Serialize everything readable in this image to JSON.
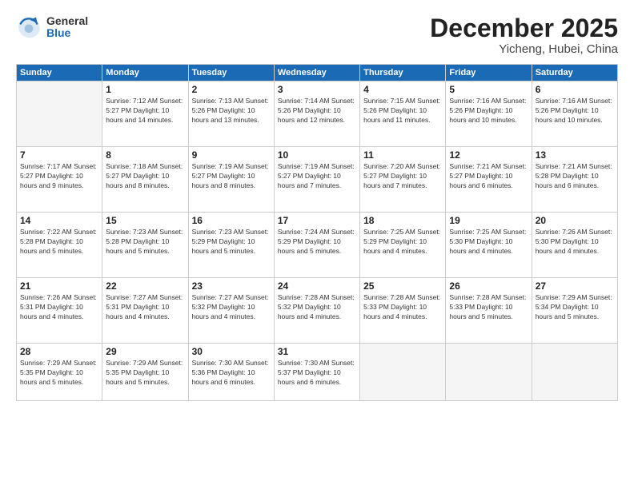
{
  "logo": {
    "general": "General",
    "blue": "Blue"
  },
  "header": {
    "month": "December 2025",
    "location": "Yicheng, Hubei, China"
  },
  "weekdays": [
    "Sunday",
    "Monday",
    "Tuesday",
    "Wednesday",
    "Thursday",
    "Friday",
    "Saturday"
  ],
  "weeks": [
    [
      {
        "day": "",
        "info": ""
      },
      {
        "day": "1",
        "info": "Sunrise: 7:12 AM\nSunset: 5:27 PM\nDaylight: 10 hours\nand 14 minutes."
      },
      {
        "day": "2",
        "info": "Sunrise: 7:13 AM\nSunset: 5:26 PM\nDaylight: 10 hours\nand 13 minutes."
      },
      {
        "day": "3",
        "info": "Sunrise: 7:14 AM\nSunset: 5:26 PM\nDaylight: 10 hours\nand 12 minutes."
      },
      {
        "day": "4",
        "info": "Sunrise: 7:15 AM\nSunset: 5:26 PM\nDaylight: 10 hours\nand 11 minutes."
      },
      {
        "day": "5",
        "info": "Sunrise: 7:16 AM\nSunset: 5:26 PM\nDaylight: 10 hours\nand 10 minutes."
      },
      {
        "day": "6",
        "info": "Sunrise: 7:16 AM\nSunset: 5:26 PM\nDaylight: 10 hours\nand 10 minutes."
      }
    ],
    [
      {
        "day": "7",
        "info": "Sunrise: 7:17 AM\nSunset: 5:27 PM\nDaylight: 10 hours\nand 9 minutes."
      },
      {
        "day": "8",
        "info": "Sunrise: 7:18 AM\nSunset: 5:27 PM\nDaylight: 10 hours\nand 8 minutes."
      },
      {
        "day": "9",
        "info": "Sunrise: 7:19 AM\nSunset: 5:27 PM\nDaylight: 10 hours\nand 8 minutes."
      },
      {
        "day": "10",
        "info": "Sunrise: 7:19 AM\nSunset: 5:27 PM\nDaylight: 10 hours\nand 7 minutes."
      },
      {
        "day": "11",
        "info": "Sunrise: 7:20 AM\nSunset: 5:27 PM\nDaylight: 10 hours\nand 7 minutes."
      },
      {
        "day": "12",
        "info": "Sunrise: 7:21 AM\nSunset: 5:27 PM\nDaylight: 10 hours\nand 6 minutes."
      },
      {
        "day": "13",
        "info": "Sunrise: 7:21 AM\nSunset: 5:28 PM\nDaylight: 10 hours\nand 6 minutes."
      }
    ],
    [
      {
        "day": "14",
        "info": "Sunrise: 7:22 AM\nSunset: 5:28 PM\nDaylight: 10 hours\nand 5 minutes."
      },
      {
        "day": "15",
        "info": "Sunrise: 7:23 AM\nSunset: 5:28 PM\nDaylight: 10 hours\nand 5 minutes."
      },
      {
        "day": "16",
        "info": "Sunrise: 7:23 AM\nSunset: 5:29 PM\nDaylight: 10 hours\nand 5 minutes."
      },
      {
        "day": "17",
        "info": "Sunrise: 7:24 AM\nSunset: 5:29 PM\nDaylight: 10 hours\nand 5 minutes."
      },
      {
        "day": "18",
        "info": "Sunrise: 7:25 AM\nSunset: 5:29 PM\nDaylight: 10 hours\nand 4 minutes."
      },
      {
        "day": "19",
        "info": "Sunrise: 7:25 AM\nSunset: 5:30 PM\nDaylight: 10 hours\nand 4 minutes."
      },
      {
        "day": "20",
        "info": "Sunrise: 7:26 AM\nSunset: 5:30 PM\nDaylight: 10 hours\nand 4 minutes."
      }
    ],
    [
      {
        "day": "21",
        "info": "Sunrise: 7:26 AM\nSunset: 5:31 PM\nDaylight: 10 hours\nand 4 minutes."
      },
      {
        "day": "22",
        "info": "Sunrise: 7:27 AM\nSunset: 5:31 PM\nDaylight: 10 hours\nand 4 minutes."
      },
      {
        "day": "23",
        "info": "Sunrise: 7:27 AM\nSunset: 5:32 PM\nDaylight: 10 hours\nand 4 minutes."
      },
      {
        "day": "24",
        "info": "Sunrise: 7:28 AM\nSunset: 5:32 PM\nDaylight: 10 hours\nand 4 minutes."
      },
      {
        "day": "25",
        "info": "Sunrise: 7:28 AM\nSunset: 5:33 PM\nDaylight: 10 hours\nand 4 minutes."
      },
      {
        "day": "26",
        "info": "Sunrise: 7:28 AM\nSunset: 5:33 PM\nDaylight: 10 hours\nand 5 minutes."
      },
      {
        "day": "27",
        "info": "Sunrise: 7:29 AM\nSunset: 5:34 PM\nDaylight: 10 hours\nand 5 minutes."
      }
    ],
    [
      {
        "day": "28",
        "info": "Sunrise: 7:29 AM\nSunset: 5:35 PM\nDaylight: 10 hours\nand 5 minutes."
      },
      {
        "day": "29",
        "info": "Sunrise: 7:29 AM\nSunset: 5:35 PM\nDaylight: 10 hours\nand 5 minutes."
      },
      {
        "day": "30",
        "info": "Sunrise: 7:30 AM\nSunset: 5:36 PM\nDaylight: 10 hours\nand 6 minutes."
      },
      {
        "day": "31",
        "info": "Sunrise: 7:30 AM\nSunset: 5:37 PM\nDaylight: 10 hours\nand 6 minutes."
      },
      {
        "day": "",
        "info": ""
      },
      {
        "day": "",
        "info": ""
      },
      {
        "day": "",
        "info": ""
      }
    ]
  ]
}
